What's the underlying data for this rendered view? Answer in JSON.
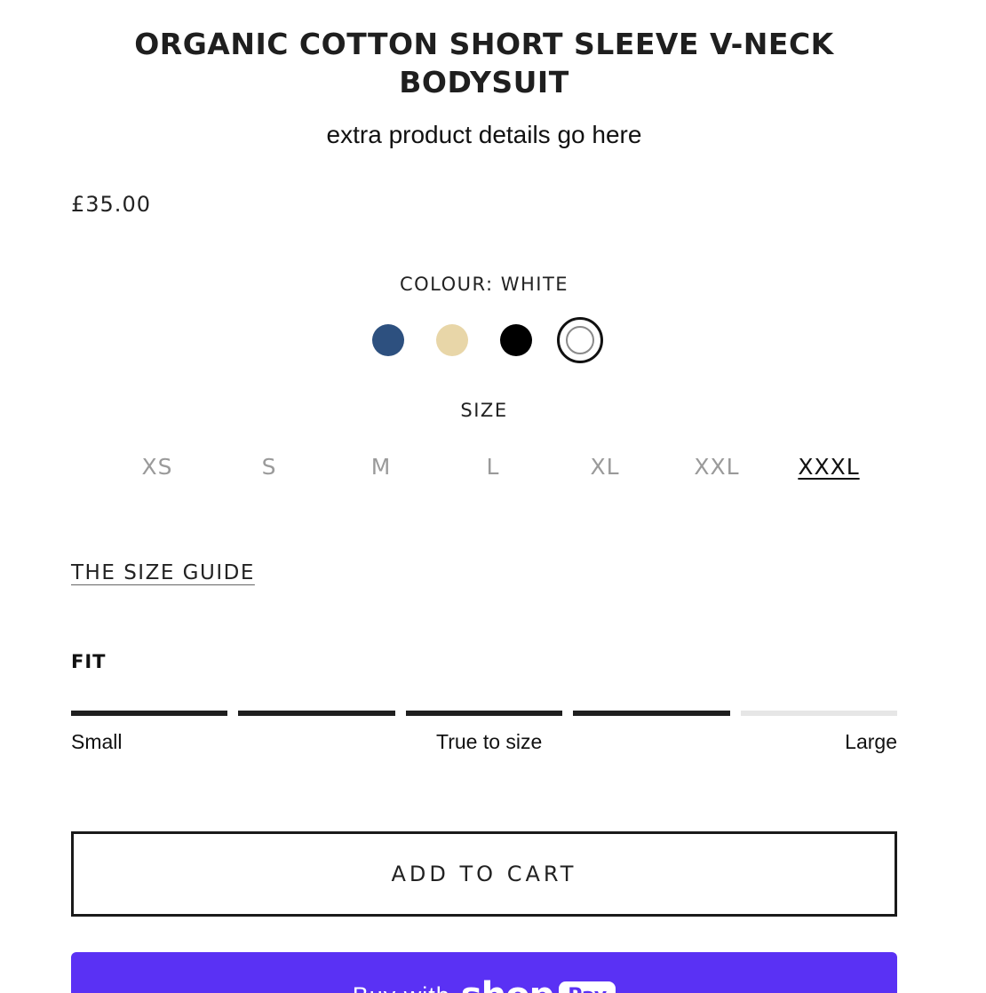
{
  "product": {
    "title": "ORGANIC COTTON SHORT SLEEVE V-NECK BODYSUIT",
    "subtitle": "extra product details go here",
    "price": "£35.00"
  },
  "colour": {
    "label": "COLOUR: WHITE",
    "swatches": [
      {
        "name": "navy",
        "color": "#2d507f",
        "selected": false
      },
      {
        "name": "cream",
        "color": "#e8d6a8",
        "selected": false
      },
      {
        "name": "black",
        "color": "#000000",
        "selected": false
      },
      {
        "name": "white",
        "color": "#ffffff",
        "selected": true
      }
    ]
  },
  "size": {
    "label": "SIZE",
    "options": [
      "XS",
      "S",
      "M",
      "L",
      "XL",
      "XXL",
      "XXXL"
    ],
    "selected": "XXXL"
  },
  "size_guide": {
    "label": "THE SIZE GUIDE"
  },
  "fit": {
    "heading": "FIT",
    "segments_total": 5,
    "segments_filled": 4,
    "active_color": "#1f1f1f",
    "inactive_color": "#e6e6e6",
    "labels": {
      "small": "Small",
      "middle": "True to size",
      "large": "Large"
    }
  },
  "actions": {
    "add_to_cart": "ADD TO CART",
    "shop_pay": {
      "buy_with": "Buy with",
      "shop": "shop",
      "pay": "Pay",
      "color": "#5a31f4"
    }
  }
}
